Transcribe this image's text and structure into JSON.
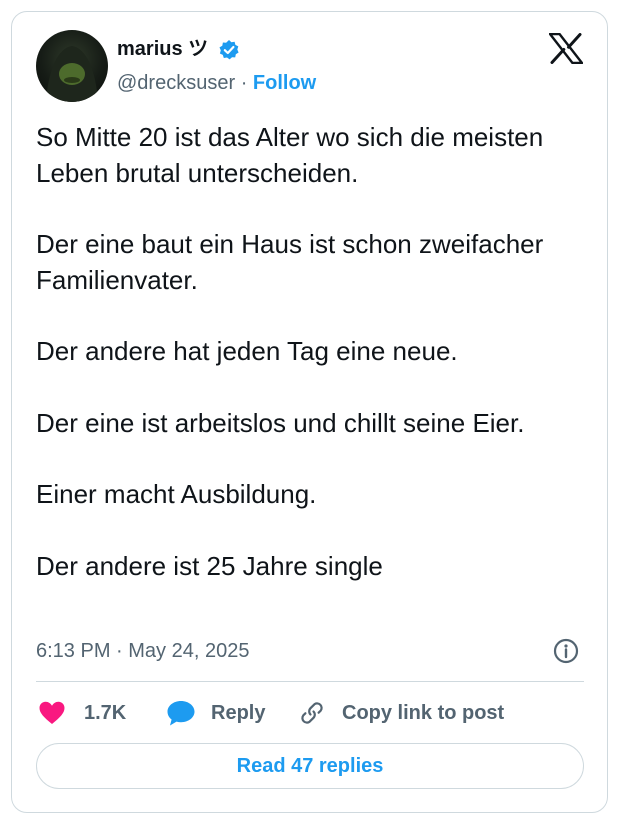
{
  "author": {
    "name": "marius ツ",
    "handle": "@drecksuser",
    "separator": "·",
    "follow_label": "Follow"
  },
  "tweet": {
    "paragraphs": [
      "So Mitte 20 ist das Alter wo sich die meisten Leben brutal unterscheiden.",
      "Der eine baut ein Haus ist schon zweifacher Familienvater.",
      "Der andere hat jeden Tag eine neue.",
      "Der eine ist arbeitslos und chillt seine Eier.",
      "Einer macht Ausbildung.",
      "Der andere ist 25 Jahre single"
    ],
    "timestamp": "6:13 PM · May 24, 2025"
  },
  "actions": {
    "like_count": "1.7K",
    "reply_label": "Reply",
    "copy_link_label": "Copy link to post"
  },
  "read_replies_label": "Read 47 replies",
  "colors": {
    "accent": "#1d9bf0",
    "like": "#f91880",
    "text": "#0f1419",
    "muted": "#536471",
    "border": "#cfd9de"
  },
  "icons": [
    "avatar",
    "verified-badge-icon",
    "x-logo-icon",
    "info-icon",
    "heart-icon",
    "reply-bubble-icon",
    "link-icon"
  ]
}
